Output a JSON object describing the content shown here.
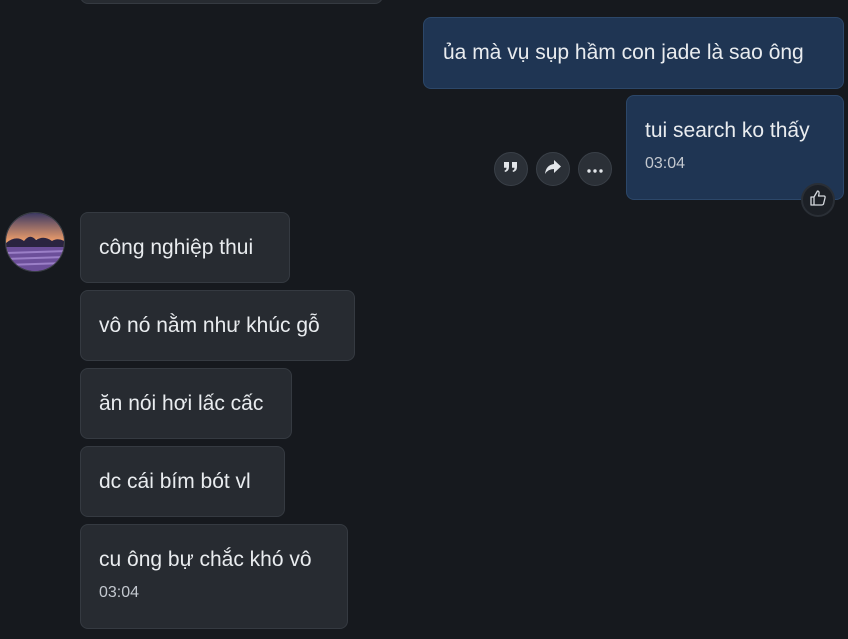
{
  "outgoing": [
    {
      "text": "ủa mà vụ sụp hầm con jade là sao ông"
    },
    {
      "text": "tui search ko thấy",
      "time": "03:04"
    }
  ],
  "incoming": [
    {
      "text": "công nghiệp thui"
    },
    {
      "text": "vô nó nằm như khúc gỗ"
    },
    {
      "text": "ăn nói hơi lấc cấc"
    },
    {
      "text": "dc cái bím bót vl"
    },
    {
      "text": "cu ông bự chắc khó vô",
      "time": "03:04"
    }
  ],
  "message_actions": {
    "icons": [
      "quote-icon",
      "forward-icon",
      "more-icon"
    ]
  },
  "reaction": {
    "icon": "thumbs-up-icon"
  },
  "colors": {
    "background": "#16191e",
    "outgoing_bubble": "#1f3553",
    "incoming_bubble": "#272b31"
  }
}
